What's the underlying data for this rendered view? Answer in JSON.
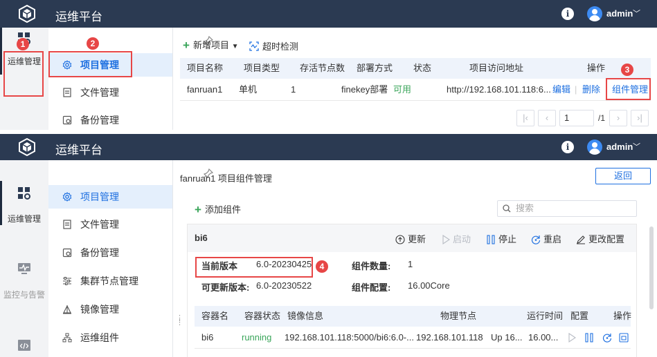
{
  "app": {
    "title": "运维平台",
    "info_glyph": "i",
    "username": "admin"
  },
  "rail": {
    "ops": "运维管理",
    "monitor": "监控与告警"
  },
  "nav": {
    "project": "项目管理",
    "files": "文件管理",
    "backup": "备份管理",
    "cluster": "集群节点管理",
    "image": "镜像管理",
    "component": "运维组件"
  },
  "callouts": [
    "1",
    "2",
    "3",
    "4"
  ],
  "panel1": {
    "toolbar": {
      "new_project": "新增项目",
      "timeout_check": "超时检测"
    },
    "table": {
      "headers": [
        "项目名称",
        "项目类型",
        "存活节点数",
        "部署方式",
        "状态",
        "项目访问地址",
        "操作"
      ],
      "row": {
        "name": "fanruan1",
        "type": "单机",
        "alive": "1",
        "deploy": "finekey部署",
        "status": "可用",
        "url": "http://192.168.101.118:6...",
        "edit": "编辑",
        "sep": "|",
        "delete": "删除",
        "manage": "组件管理"
      }
    },
    "pagination": {
      "page": "1",
      "total": "/1"
    }
  },
  "panel2": {
    "title": "fanruan1 项目组件管理",
    "back": "返回",
    "add_component": "添加组件",
    "search_placeholder": "搜索",
    "card": {
      "name": "bi6",
      "actions": {
        "update": "更新",
        "start": "启动",
        "stop": "停止",
        "restart": "重启",
        "edit_config": "更改配置"
      },
      "current_version_label": "当前版本",
      "current_version": "6.0-20230425",
      "updatable_label": "可更新版本:",
      "updatable_version": "6.0-20230522",
      "count_label": "组件数量:",
      "count": "1",
      "config_label": "组件配置:",
      "config": "16.00Core"
    },
    "containers": {
      "headers": [
        "容器名",
        "容器状态",
        "镜像信息",
        "物理节点",
        "运行时间",
        "配置",
        "操作"
      ],
      "row": {
        "name": "bi6",
        "status": "running",
        "image": "192.168.101.118:5000/bi6:6.0-...",
        "node": "192.168.101.118",
        "uptime": "Up 16...",
        "config": "16.00..."
      }
    }
  },
  "colors": {
    "topbar": "#2b3a52",
    "accent": "#1d6fe0",
    "callout": "#e74646",
    "success": "#3aa55a"
  }
}
